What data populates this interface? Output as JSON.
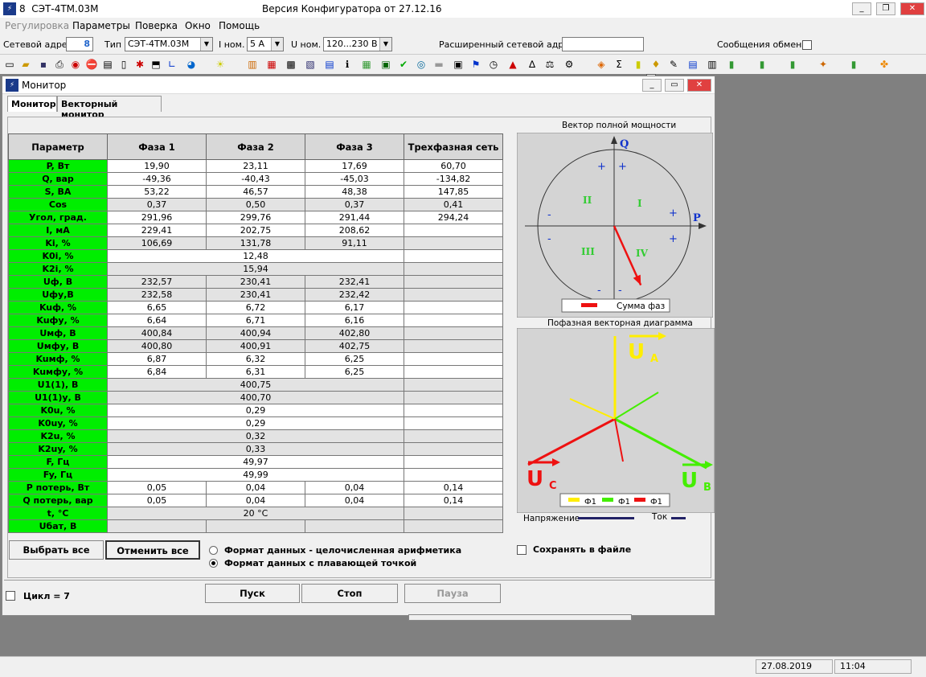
{
  "app": {
    "number": "8",
    "title": "СЭТ-4ТМ.03М",
    "version": "Версия Конфигуратора  от 27.12.16"
  },
  "menu": [
    "Регулировка",
    "Параметры",
    "Поверка",
    "Окно",
    "Помощь"
  ],
  "toolbar": {
    "net_addr_label": "Сетевой адрес",
    "net_addr_value": "8",
    "type_label": "Тип",
    "type_value": "СЭТ-4ТМ.03М",
    "inom_label": "I ном.",
    "inom_value": "5 А",
    "unom_label": "U ном.",
    "unom_value": "120...230 В",
    "ext_addr_label": "Расширенный сетевой адрес",
    "exchange_label": "Сообщения обмена"
  },
  "monitor": {
    "title": "Монитор",
    "tabs": [
      "Монитор",
      "Векторный монитор"
    ],
    "headers": [
      "Параметр",
      "Фаза 1",
      "Фаза 2",
      "Фаза 3",
      "Трехфазная сеть"
    ],
    "rows": [
      {
        "p": "P, Вт",
        "v": [
          "19,90",
          "23,11",
          "17,69",
          "60,70"
        ]
      },
      {
        "p": "Q, вар",
        "v": [
          "-49,36",
          "-40,43",
          "-45,03",
          "-134,82"
        ]
      },
      {
        "p": "S, ВА",
        "v": [
          "53,22",
          "46,57",
          "48,38",
          "147,85"
        ]
      },
      {
        "p": "Cos",
        "v": [
          "0,37",
          "0,50",
          "0,37",
          "0,41"
        ]
      },
      {
        "p": "Угол, град.",
        "v": [
          "291,96",
          "299,76",
          "291,44",
          "294,24"
        ]
      },
      {
        "p": "I, мА",
        "v": [
          "229,41",
          "202,75",
          "208,62",
          ""
        ]
      },
      {
        "p": "Ki, %",
        "v": [
          "106,69",
          "131,78",
          "91,11",
          ""
        ]
      },
      {
        "p": "K0i, %",
        "span": "12,48"
      },
      {
        "p": "K2i, %",
        "span": "15,94"
      },
      {
        "p": "Uф, В",
        "v": [
          "232,57",
          "230,41",
          "232,41",
          ""
        ]
      },
      {
        "p": "Uфу,В",
        "v": [
          "232,58",
          "230,41",
          "232,42",
          ""
        ]
      },
      {
        "p": "Kuф, %",
        "v": [
          "6,65",
          "6,72",
          "6,17",
          ""
        ]
      },
      {
        "p": "Kuфу, %",
        "v": [
          "6,64",
          "6,71",
          "6,16",
          ""
        ]
      },
      {
        "p": "Uмф, В",
        "v": [
          "400,84",
          "400,94",
          "402,80",
          ""
        ]
      },
      {
        "p": "Uмфу, В",
        "v": [
          "400,80",
          "400,91",
          "402,75",
          ""
        ]
      },
      {
        "p": "Kuмф, %",
        "v": [
          "6,87",
          "6,32",
          "6,25",
          ""
        ]
      },
      {
        "p": "Kuмфу, %",
        "v": [
          "6,84",
          "6,31",
          "6,25",
          ""
        ]
      },
      {
        "p": "U1(1), В",
        "span": "400,75"
      },
      {
        "p": "U1(1)у, В",
        "span": "400,70"
      },
      {
        "p": "K0u, %",
        "span": "0,29"
      },
      {
        "p": "K0uy, %",
        "span": "0,29"
      },
      {
        "p": "K2u, %",
        "span": "0,32"
      },
      {
        "p": "K2uy, %",
        "span": "0,33"
      },
      {
        "p": "F, Гц",
        "span": "49,97"
      },
      {
        "p": "Fy, Гц",
        "span": "49,99"
      },
      {
        "p": "P потерь, Вт",
        "v": [
          "0,05",
          "0,04",
          "0,04",
          "0,14"
        ]
      },
      {
        "p": "Q потерь, вар",
        "v": [
          "0,05",
          "0,04",
          "0,04",
          "0,14"
        ]
      },
      {
        "p": "t, °C",
        "span": "20 °C"
      },
      {
        "p": "Uбат, В",
        "v": [
          "",
          "",
          "",
          ""
        ]
      }
    ],
    "select_all": "Выбрать все",
    "cancel_all": "Отменить все",
    "fmt_int": "Формат данных - целочисленная арифметика",
    "fmt_float": "Формат данных с плавающей точкой",
    "save_file": "Сохранять в файле",
    "cycle": "Цикл = 7",
    "start": "Пуск",
    "stop": "Стоп",
    "pause": "Пауза",
    "power_vector": {
      "title": "Вектор полной мощности",
      "q": "Q",
      "p": "P",
      "quadrants": [
        "I",
        "II",
        "III",
        "IV"
      ],
      "plus": "+",
      "minus": "-",
      "legend": "Сумма фаз",
      "angle_deg": 294.24,
      "magnitude": 0.85
    },
    "phase_diagram": {
      "title": "Пофазная векторная диаграмма",
      "ua": "U",
      "ua_sub": "A",
      "ub": "U",
      "ub_sub": "B",
      "uc": "U",
      "uc_sub": "C",
      "legend": [
        "Ф1",
        "Ф1",
        "Ф1"
      ],
      "voltage_label": "Напряжение",
      "current_label": "Ток",
      "colors": {
        "a": "#ffee00",
        "b": "#44ee00",
        "c": "#ee1111"
      }
    }
  },
  "status": {
    "date": "27.08.2019",
    "time": "11:04"
  }
}
